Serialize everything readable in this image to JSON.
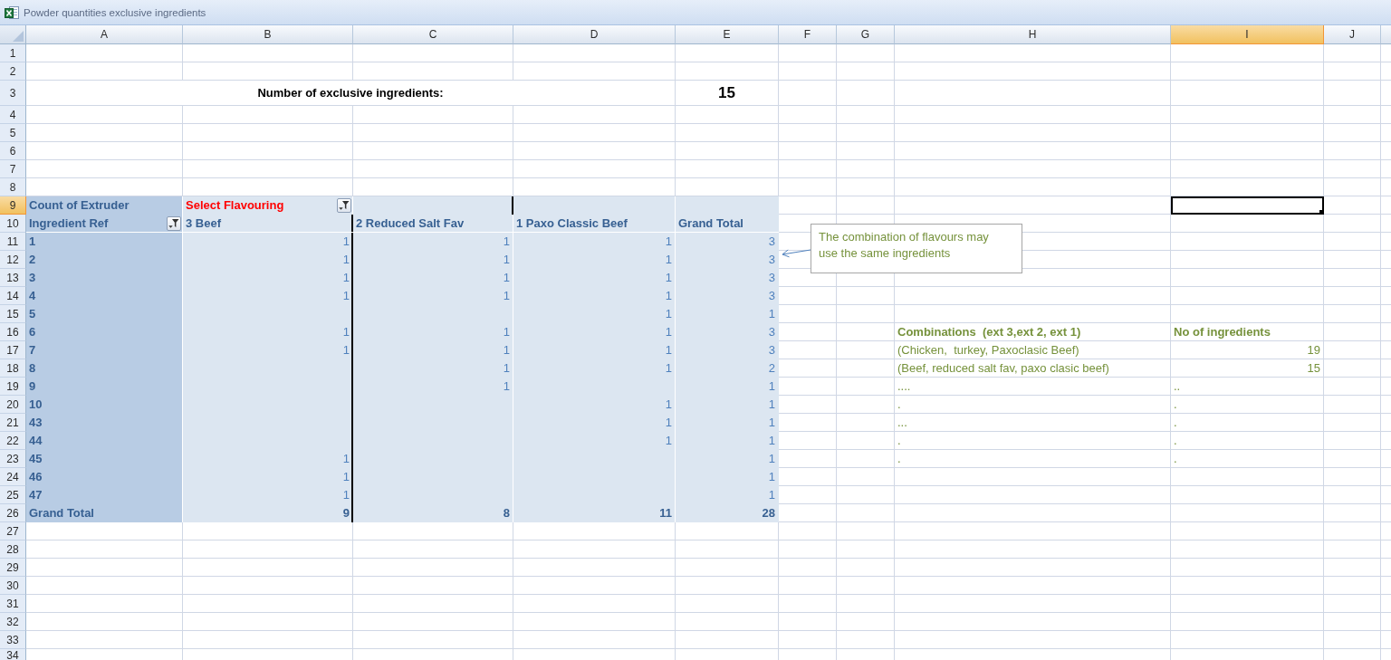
{
  "window": {
    "title": "Powder quantities exclusive ingredients"
  },
  "columns": [
    {
      "label": "A",
      "selected": false
    },
    {
      "label": "B",
      "selected": false
    },
    {
      "label": "C",
      "selected": false
    },
    {
      "label": "D",
      "selected": false
    },
    {
      "label": "E",
      "selected": false
    },
    {
      "label": "F",
      "selected": false
    },
    {
      "label": "G",
      "selected": false
    },
    {
      "label": "H",
      "selected": false
    },
    {
      "label": "I",
      "selected": true
    },
    {
      "label": "J",
      "selected": false
    }
  ],
  "rows": [
    {
      "label": "1",
      "selected": false
    },
    {
      "label": "2",
      "selected": false
    },
    {
      "label": "3",
      "selected": false
    },
    {
      "label": "4",
      "selected": false
    },
    {
      "label": "5",
      "selected": false
    },
    {
      "label": "6",
      "selected": false
    },
    {
      "label": "7",
      "selected": false
    },
    {
      "label": "8",
      "selected": false
    },
    {
      "label": "9",
      "selected": true
    },
    {
      "label": "10",
      "selected": false
    },
    {
      "label": "11",
      "selected": false
    },
    {
      "label": "12",
      "selected": false
    },
    {
      "label": "13",
      "selected": false
    },
    {
      "label": "14",
      "selected": false
    },
    {
      "label": "15",
      "selected": false
    },
    {
      "label": "16",
      "selected": false
    },
    {
      "label": "17",
      "selected": false
    },
    {
      "label": "18",
      "selected": false
    },
    {
      "label": "19",
      "selected": false
    },
    {
      "label": "20",
      "selected": false
    },
    {
      "label": "21",
      "selected": false
    },
    {
      "label": "22",
      "selected": false
    },
    {
      "label": "23",
      "selected": false
    },
    {
      "label": "24",
      "selected": false
    },
    {
      "label": "25",
      "selected": false
    },
    {
      "label": "26",
      "selected": false
    },
    {
      "label": "27",
      "selected": false
    },
    {
      "label": "28",
      "selected": false
    },
    {
      "label": "29",
      "selected": false
    },
    {
      "label": "30",
      "selected": false
    },
    {
      "label": "31",
      "selected": false
    },
    {
      "label": "32",
      "selected": false
    },
    {
      "label": "33",
      "selected": false
    },
    {
      "label": "34",
      "selected": false
    }
  ],
  "summary": {
    "label": "Number of exclusive ingredients:",
    "value": "15"
  },
  "pivot": {
    "data_field": "Count of Extruder",
    "filter_label": "Select Flavouring",
    "row_field": "Ingredient Ref",
    "column_headers": [
      "3 Beef",
      "2 Reduced Salt Fav",
      "1 Paxo Classic Beef",
      "Grand Total"
    ],
    "rows": [
      {
        "label": "1",
        "beef": "1",
        "reduced_salt_fav": "1",
        "paxo_classic_beef": "1",
        "grand_total": "3"
      },
      {
        "label": "2",
        "beef": "1",
        "reduced_salt_fav": "1",
        "paxo_classic_beef": "1",
        "grand_total": "3"
      },
      {
        "label": "3",
        "beef": "1",
        "reduced_salt_fav": "1",
        "paxo_classic_beef": "1",
        "grand_total": "3"
      },
      {
        "label": "4",
        "beef": "1",
        "reduced_salt_fav": "1",
        "paxo_classic_beef": "1",
        "grand_total": "3"
      },
      {
        "label": "5",
        "paxo_classic_beef": "1",
        "grand_total": "1"
      },
      {
        "label": "6",
        "beef": "1",
        "reduced_salt_fav": "1",
        "paxo_classic_beef": "1",
        "grand_total": "3"
      },
      {
        "label": "7",
        "beef": "1",
        "reduced_salt_fav": "1",
        "paxo_classic_beef": "1",
        "grand_total": "3"
      },
      {
        "label": "8",
        "reduced_salt_fav": "1",
        "paxo_classic_beef": "1",
        "grand_total": "2"
      },
      {
        "label": "9",
        "reduced_salt_fav": "1",
        "grand_total": "1"
      },
      {
        "label": "10",
        "paxo_classic_beef": "1",
        "grand_total": "1"
      },
      {
        "label": "43",
        "paxo_classic_beef": "1",
        "grand_total": "1"
      },
      {
        "label": "44",
        "paxo_classic_beef": "1",
        "grand_total": "1"
      },
      {
        "label": "45",
        "beef": "1",
        "grand_total": "1"
      },
      {
        "label": "46",
        "beef": "1",
        "grand_total": "1"
      },
      {
        "label": "47",
        "beef": "1",
        "grand_total": "1"
      }
    ],
    "total": {
      "label": "Grand Total",
      "beef": "9",
      "reduced_salt_fav": "8",
      "paxo_classic_beef": "11",
      "grand_total": "28"
    }
  },
  "comment": {
    "text": "The combination of flavours may use the same ingredients"
  },
  "combinations": {
    "columns": [
      "Combinations  (ext 3,ext 2, ext 1)",
      "No of ingredients"
    ],
    "rows": [
      {
        "kind": "number",
        "cells": [
          "(Chicken,  turkey, Paxoclasic Beef)",
          "19"
        ]
      },
      {
        "kind": "number",
        "cells": [
          "(Beef, reduced salt fav, paxo clasic beef)",
          "15"
        ]
      },
      {
        "kind": "text",
        "cells": [
          "....",
          ".."
        ]
      },
      {
        "kind": "text",
        "cells": [
          ".",
          "."
        ]
      },
      {
        "kind": "text",
        "cells": [
          "...",
          "."
        ]
      },
      {
        "kind": "text",
        "cells": [
          ".",
          "."
        ]
      },
      {
        "kind": "text",
        "cells": [
          ".",
          "."
        ]
      }
    ]
  }
}
